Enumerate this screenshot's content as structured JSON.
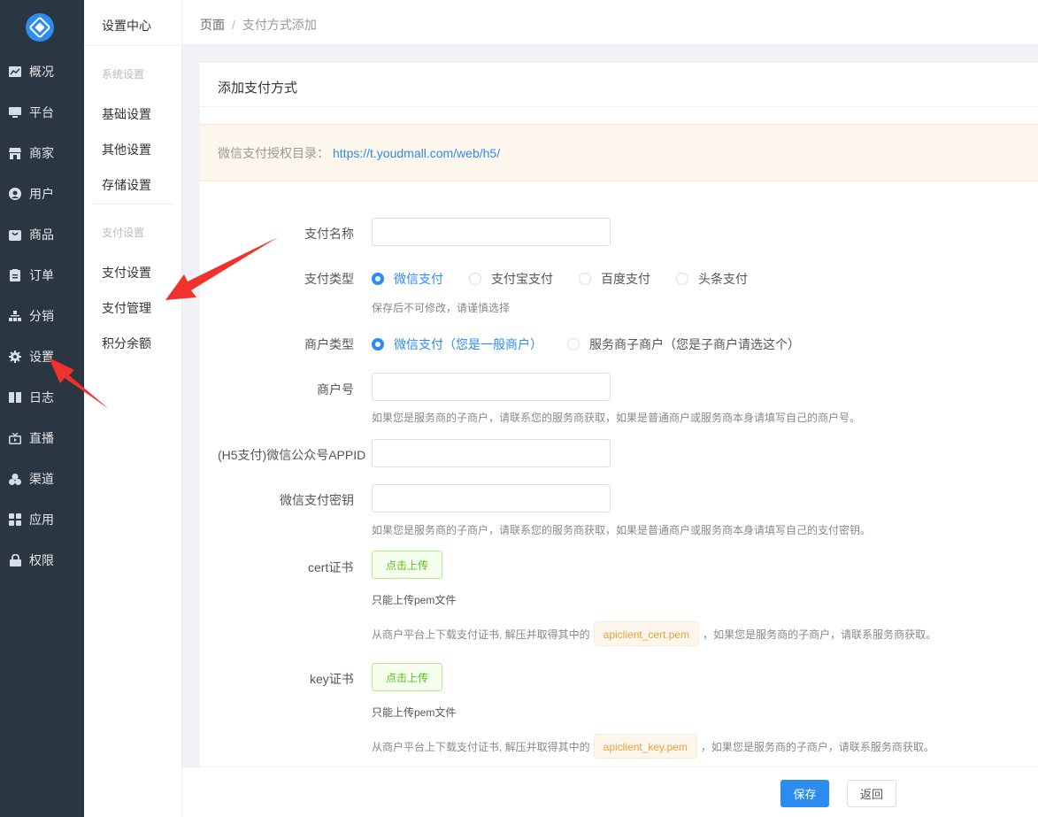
{
  "nav": {
    "items": [
      {
        "label": "概况",
        "icon": "chart-icon"
      },
      {
        "label": "平台",
        "icon": "monitor-icon"
      },
      {
        "label": "商家",
        "icon": "store-icon"
      },
      {
        "label": "用户",
        "icon": "user-icon"
      },
      {
        "label": "商品",
        "icon": "bag-icon"
      },
      {
        "label": "订单",
        "icon": "clipboard-icon"
      },
      {
        "label": "分销",
        "icon": "sitemap-icon"
      },
      {
        "label": "设置",
        "icon": "gear-icon"
      },
      {
        "label": "日志",
        "icon": "book-icon"
      },
      {
        "label": "直播",
        "icon": "tv-icon"
      },
      {
        "label": "渠道",
        "icon": "cubes-icon"
      },
      {
        "label": "应用",
        "icon": "grid-icon"
      },
      {
        "label": "权限",
        "icon": "lock-icon"
      }
    ]
  },
  "submenu": {
    "title": "设置中心",
    "group1": "系统设置",
    "items1": [
      "基础设置",
      "其他设置",
      "存储设置"
    ],
    "group2": "支付设置",
    "items2": [
      "支付设置",
      "支付管理",
      "积分余额"
    ]
  },
  "breadcrumb": {
    "root": "页面",
    "separator": "/",
    "current": "支付方式添加"
  },
  "card": {
    "title": "添加支付方式",
    "notice_label": "微信支付授权目录：",
    "notice_url": "https://t.youdmall.com/web/h5/"
  },
  "form": {
    "pay_name_label": "支付名称",
    "pay_type_label": "支付类型",
    "pay_types": [
      "微信支付",
      "支付宝支付",
      "百度支付",
      "头条支付"
    ],
    "pay_type_hint": "保存后不可修改，请谨慎选择",
    "merchant_type_label": "商户类型",
    "merchant_types": [
      "微信支付（您是一般商户）",
      "服务商子商户（您是子商户请选这个）"
    ],
    "mch_id_label": "商户号",
    "mch_id_hint": "如果您是服务商的子商户，请联系您的服务商获取，如果是普通商户或服务商本身请填写自己的商户号。",
    "appid_label": "(H5支付)微信公众号APPID",
    "secret_label": "微信支付密钥",
    "secret_hint": "如果您是服务商的子商户，请联系您的服务商获取，如果是普通商户或服务商本身请填写自己的支付密钥。",
    "cert_label": "cert证书",
    "upload_label": "点击上传",
    "pem_only": "只能上传pem文件",
    "cert_desc_pre": "从商户平台上下载支付证书, 解压并取得其中的",
    "cert_file": "apiclient_cert.pem",
    "desc_post": "，如果您是服务商的子商户，请联系服务商获取。",
    "key_label": "key证书",
    "key_file": "apiclient_key.pem"
  },
  "footer": {
    "save": "保存",
    "back": "返回"
  },
  "colors": {
    "nav_bg": "#2b3643",
    "primary": "#2d8cf0",
    "annotation": "#f0312c"
  }
}
